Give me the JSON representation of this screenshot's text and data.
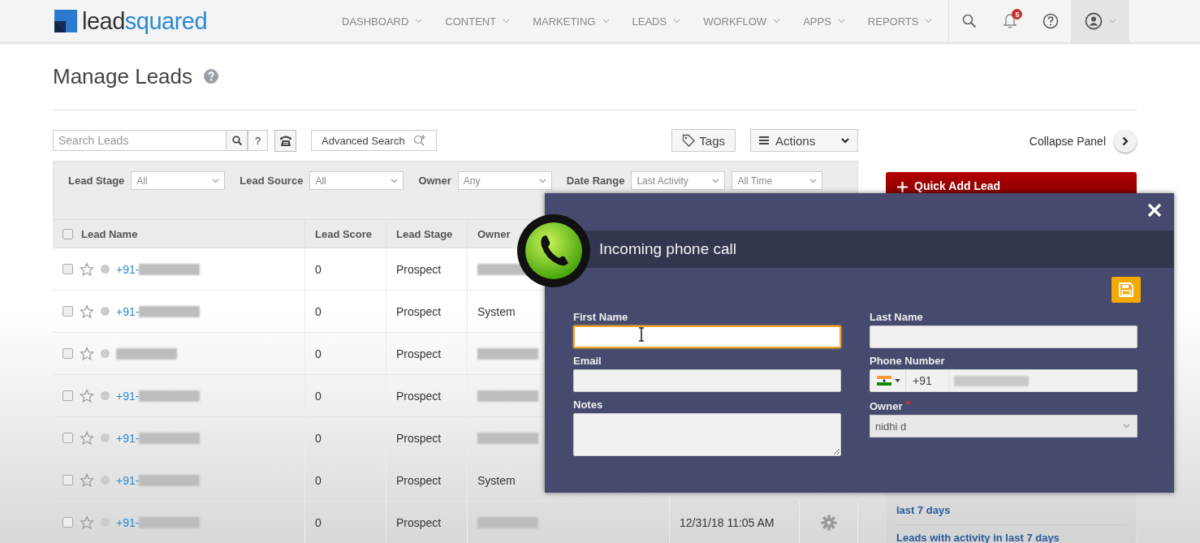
{
  "nav": {
    "logo": [
      "lead",
      "squared"
    ],
    "items": [
      {
        "label": "DASHBOARD",
        "selected": false
      },
      {
        "label": "CONTENT",
        "selected": false
      },
      {
        "label": "MARKETING",
        "selected": false
      },
      {
        "label": "LEADS",
        "selected": false
      },
      {
        "label": "WORKFLOW",
        "selected": false
      },
      {
        "label": "APPS",
        "selected": false
      },
      {
        "label": "REPORTS",
        "selected": false
      }
    ],
    "notification_count": "5"
  },
  "page": {
    "title": "Manage Leads"
  },
  "toolbar": {
    "search_placeholder": "Search Leads",
    "help": "?",
    "advanced_search": "Advanced Search",
    "tags": "Tags",
    "actions": "Actions",
    "collapse_panel": "Collapse Panel"
  },
  "filters": [
    {
      "label": "Lead Stage",
      "values": [
        "All"
      ]
    },
    {
      "label": "Lead Source",
      "values": [
        "All"
      ]
    },
    {
      "label": "Owner",
      "values": [
        "Any"
      ]
    },
    {
      "label": "Date Range",
      "values": [
        "Last Activity",
        "All Time"
      ]
    }
  ],
  "table": {
    "all_checked": false,
    "columns": [
      "Lead Name",
      "Lead Score",
      "Lead Stage",
      "Owner"
    ],
    "rows": [
      {
        "checked": false,
        "starred": false,
        "name": {
          "text": "+91-",
          "redacted": true
        },
        "score": "0",
        "stage": "Prospect",
        "owner": {
          "redacted": true
        }
      },
      {
        "checked": false,
        "starred": false,
        "name": {
          "text": "+91-",
          "redacted": true
        },
        "score": "0",
        "stage": "Prospect",
        "owner": {
          "text": "System"
        }
      },
      {
        "checked": false,
        "starred": false,
        "name": {
          "redacted": true
        },
        "score": "0",
        "stage": "Prospect",
        "owner": {
          "redacted": true
        }
      },
      {
        "checked": false,
        "starred": false,
        "name": {
          "text": "+91-",
          "redacted": true
        },
        "score": "0",
        "stage": "Prospect",
        "owner": {
          "redacted": true
        }
      },
      {
        "checked": false,
        "starred": false,
        "name": {
          "text": "+91-",
          "redacted": true
        },
        "score": "0",
        "stage": "Prospect",
        "owner": {
          "redacted": true
        }
      },
      {
        "checked": false,
        "starred": false,
        "name": {
          "text": "+91-",
          "redacted": true
        },
        "score": "0",
        "stage": "Prospect",
        "owner": {
          "text": "System"
        }
      },
      {
        "checked": false,
        "starred": false,
        "name": {
          "text": "+91-",
          "redacted": true
        },
        "score": "0",
        "stage": "Prospect",
        "owner": {
          "redacted": true
        },
        "date": "12/31/18 11:05 AM",
        "actions_visible": true
      }
    ]
  },
  "side_panel": {
    "quick_add": "Quick Add Lead",
    "links": [
      "last 7 days",
      "Leads with activity in last 7 days"
    ]
  },
  "call_modal": {
    "title": "Incoming phone call",
    "fields": [
      {
        "kind": "text",
        "label": "First Name",
        "focused": true
      },
      {
        "kind": "text",
        "label": "Last Name"
      },
      {
        "kind": "text",
        "label": "Email"
      },
      {
        "kind": "phone",
        "label": "Phone Number",
        "code": "+91",
        "redacted": true
      },
      {
        "kind": "textarea",
        "label": "Notes"
      },
      {
        "kind": "select",
        "label": "Owner",
        "value": "nidhi d",
        "required_mark": "*"
      }
    ]
  }
}
